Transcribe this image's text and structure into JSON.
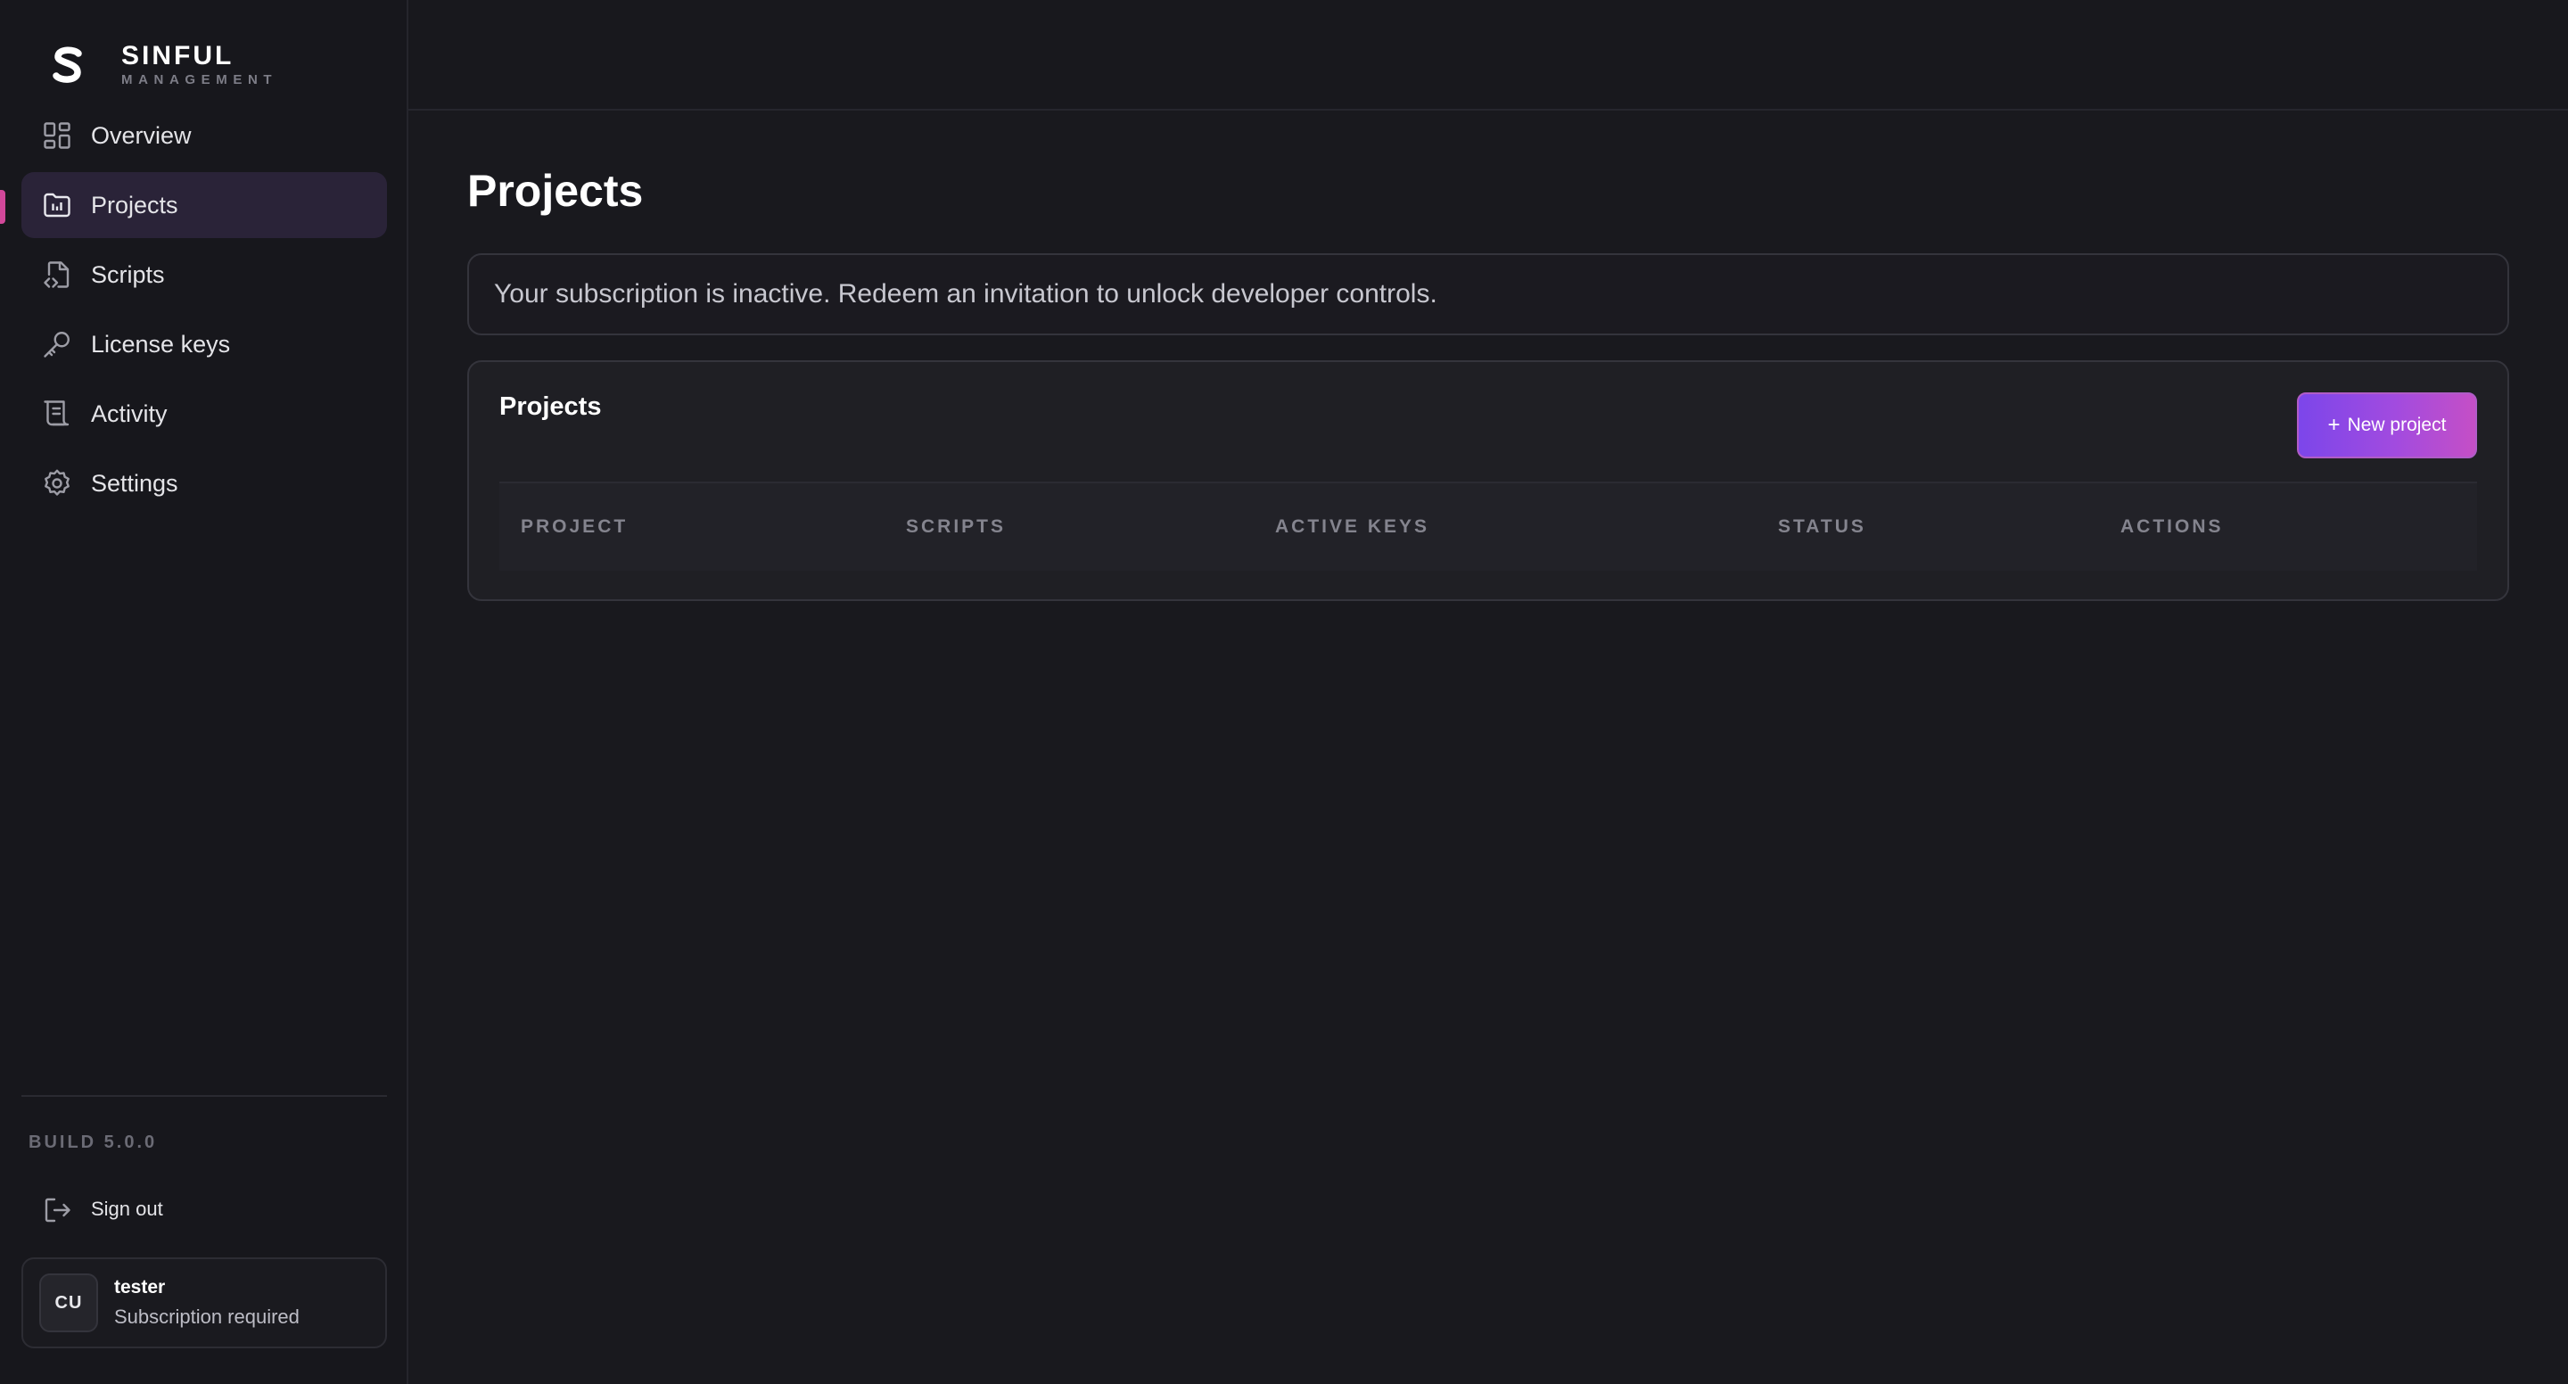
{
  "brand": {
    "name": "SINFUL",
    "subtitle": "MANAGEMENT"
  },
  "sidebar": {
    "items": [
      {
        "label": "Overview",
        "icon": "grid-icon",
        "active": false
      },
      {
        "label": "Projects",
        "icon": "folder-chart-icon",
        "active": true
      },
      {
        "label": "Scripts",
        "icon": "file-code-icon",
        "active": false
      },
      {
        "label": "License keys",
        "icon": "key-icon",
        "active": false
      },
      {
        "label": "Activity",
        "icon": "list-icon",
        "active": false
      },
      {
        "label": "Settings",
        "icon": "gear-icon",
        "active": false
      }
    ],
    "build": "BUILD 5.0.0",
    "signout_label": "Sign out"
  },
  "user": {
    "initials": "CU",
    "name": "tester",
    "status": "Subscription required"
  },
  "main": {
    "title": "Projects",
    "alert": "Your subscription is inactive. Redeem an invitation to unlock developer controls.",
    "panel": {
      "title": "Projects",
      "new_button": {
        "plus": "+",
        "label": "New project"
      },
      "columns": [
        "PROJECT",
        "SCRIPTS",
        "ACTIVE KEYS",
        "STATUS",
        "ACTIONS"
      ]
    }
  },
  "colors": {
    "accent": "#d2489a",
    "button_gradient_start": "#7c46ea",
    "button_gradient_end": "#c54fc6",
    "active_nav_bg": "#2a2338"
  }
}
